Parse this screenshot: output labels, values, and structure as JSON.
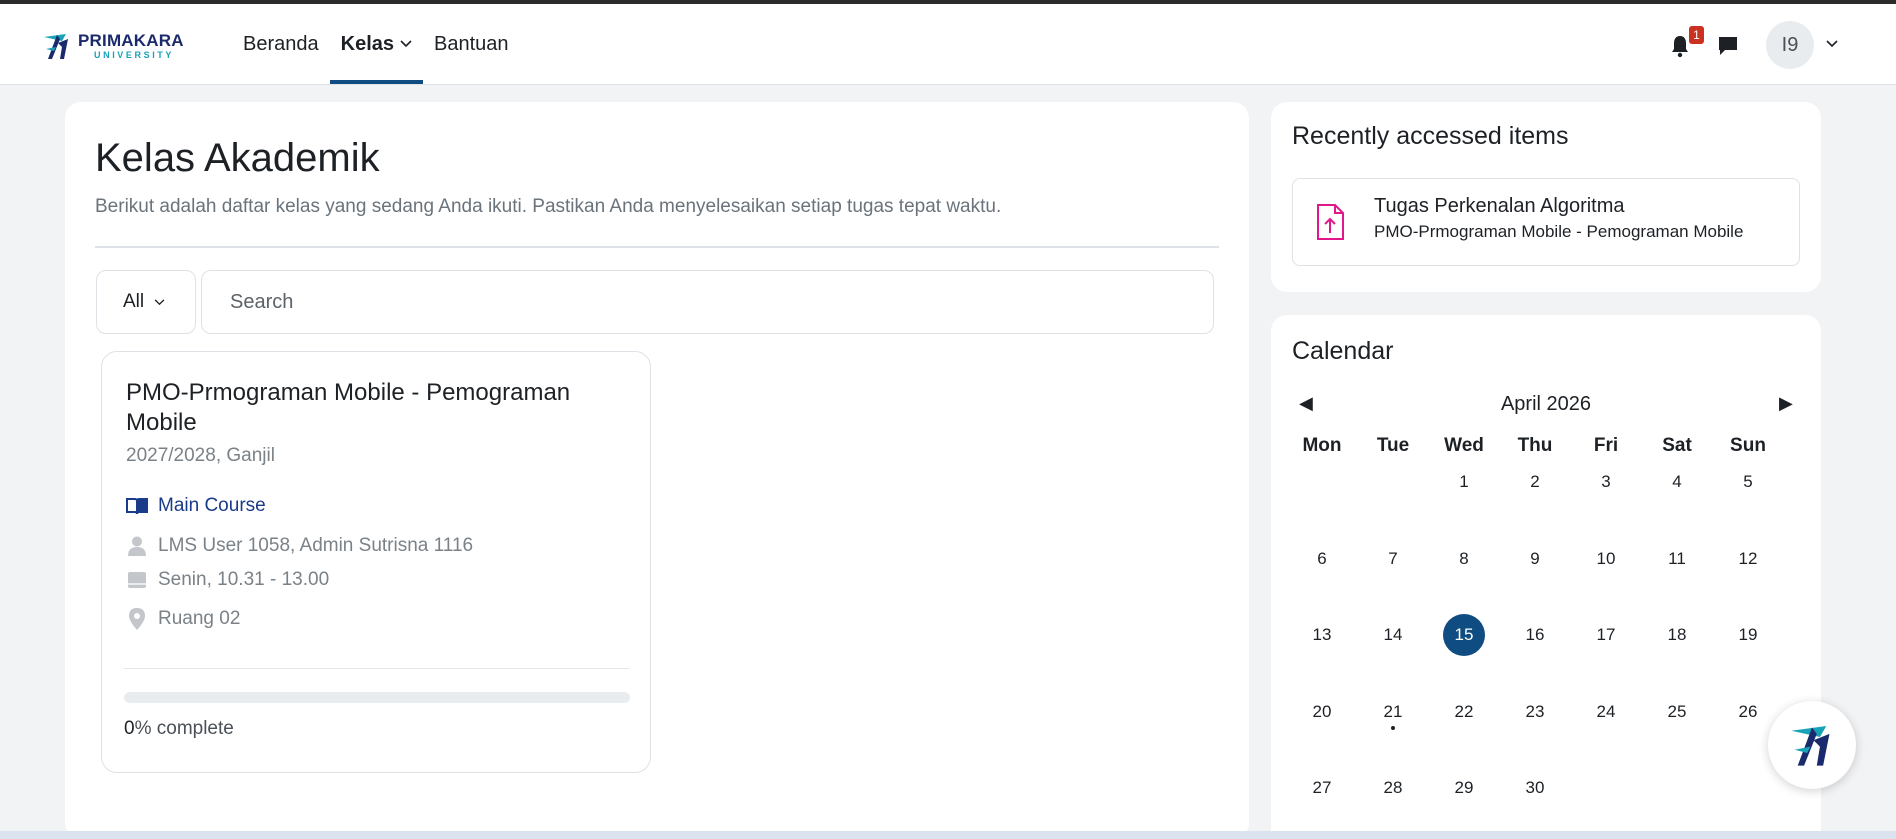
{
  "brand": {
    "name": "PRIMAKARA",
    "sub": "UNIVERSITY",
    "accent": "#0f4c81",
    "teal": "#17a2b8",
    "badge_color": "#ca3120"
  },
  "nav": {
    "items": [
      {
        "label": "Beranda"
      },
      {
        "label": "Kelas"
      },
      {
        "label": "Bantuan"
      }
    ],
    "notifications_count": "1",
    "avatar_initials": "I9"
  },
  "main": {
    "title": "Kelas Akademik",
    "description": "Berikut adalah daftar kelas yang sedang Anda ikuti. Pastikan Anda menyelesaikan setiap tugas tepat waktu.",
    "filter_value": "All",
    "search_placeholder": "Search",
    "course": {
      "title": "PMO-Prmograman Mobile - Pemograman Mobile",
      "term": "2027/2028, Ganjil",
      "category": "Main Course",
      "teachers": "LMS User 1058, Admin Sutrisna 1116",
      "schedule": "Senin, 10.31 - 13.00",
      "room": "Ruang 02",
      "progress_percent": 0,
      "progress_number": "0",
      "progress_suffix": "% complete"
    }
  },
  "recent": {
    "title": "Recently accessed items",
    "item": {
      "name": "Tugas Perkenalan Algoritma",
      "course": "PMO-Prmograman Mobile - Pemograman Mobile",
      "icon": "upload-file-icon",
      "icon_color": "#e0188c"
    }
  },
  "calendar": {
    "title": "Calendar",
    "month": "April 2026",
    "prev": "◀",
    "next": "▶",
    "weekdays": [
      "Mon",
      "Tue",
      "Wed",
      "Thu",
      "Fri",
      "Sat",
      "Sun"
    ],
    "weeks": [
      [
        "",
        "",
        "1",
        "2",
        "3",
        "4",
        "5"
      ],
      [
        "6",
        "7",
        "8",
        "9",
        "10",
        "11",
        "12"
      ],
      [
        "13",
        "14",
        "15",
        "16",
        "17",
        "18",
        "19"
      ],
      [
        "20",
        "21",
        "22",
        "23",
        "24",
        "25",
        "26"
      ],
      [
        "27",
        "28",
        "29",
        "30",
        "",
        "",
        ""
      ]
    ],
    "today": "15",
    "event_dates": [
      "21"
    ]
  }
}
